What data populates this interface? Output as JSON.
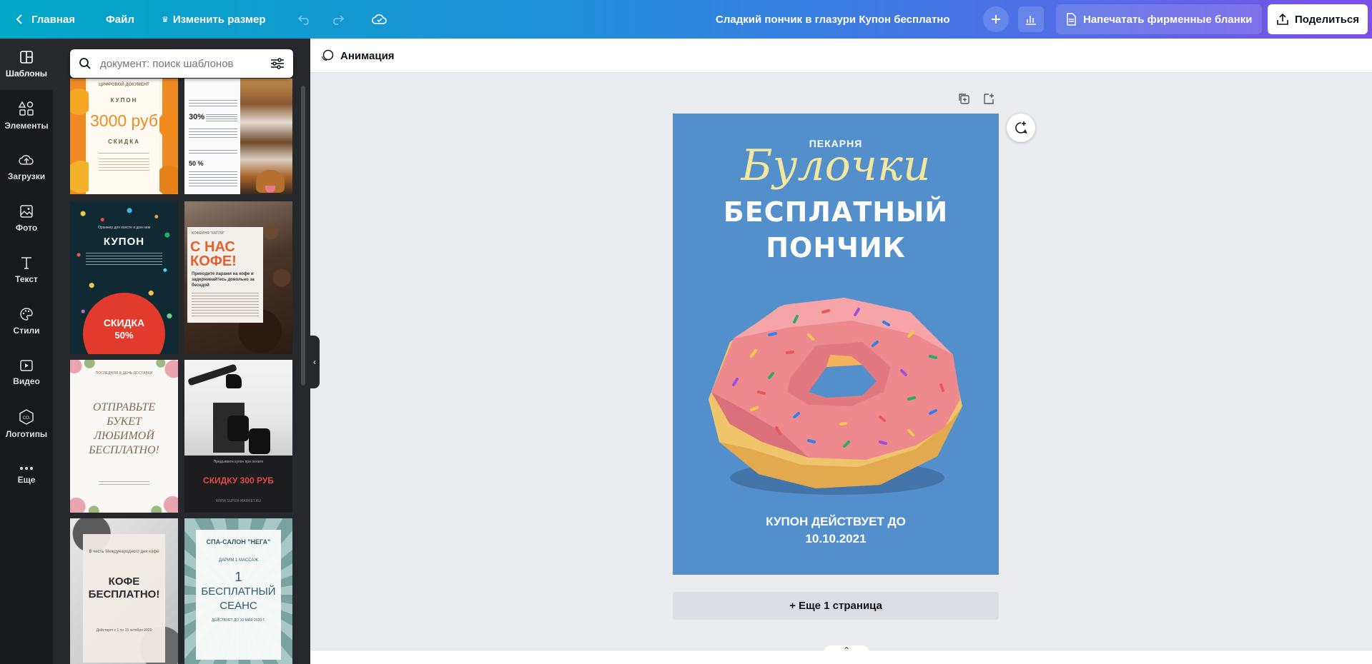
{
  "topbar": {
    "home": "Главная",
    "file": "Файл",
    "resize": "Изменить размер",
    "doc_title": "Сладкий пончик в глазури Купон бесплатно",
    "print": "Напечатать фирменные бланки",
    "share": "Поделиться"
  },
  "rail": {
    "items": [
      {
        "label": "Шаблоны",
        "icon": "templates-icon"
      },
      {
        "label": "Элементы",
        "icon": "elements-icon"
      },
      {
        "label": "Загрузки",
        "icon": "upload-icon"
      },
      {
        "label": "Фото",
        "icon": "photo-icon"
      },
      {
        "label": "Текст",
        "icon": "text-icon"
      },
      {
        "label": "Стили",
        "icon": "palette-icon"
      },
      {
        "label": "Видео",
        "icon": "video-icon"
      },
      {
        "label": "Логотипы",
        "icon": "logo-icon"
      },
      {
        "label": "Еще",
        "icon": "more-icon"
      }
    ]
  },
  "panel": {
    "search_placeholder": "документ: поиск шаблонов",
    "thumbs": {
      "t1": {
        "top": "ЦИФРОВОЙ ДОКУМЕНТ",
        "coupon": "КУПОН",
        "amount": "3000 руб",
        "discount": "СКИДКА"
      },
      "t2": {
        "p30": "30%",
        "p50": "50 %"
      },
      "t3": {
        "small": "Оранжер для холсте и дом ним",
        "title": "КУПОН",
        "discount": "СКИДКА",
        "percent": "50%"
      },
      "t4": {
        "small": "КОФЕЙНЯ \"КАПЛЯ\"",
        "title1": "С НАС",
        "title2": "КОФЕ!",
        "sub": "Приходите парами на кофе и задерживайтесь довольно за беседой"
      },
      "t5": {
        "small": "ПОСЛЕДНЯЯ В ДЕНЬ ДОСТАВКИ",
        "l1": "ОТПРАВЬТЕ",
        "l2": "БУКЕТ",
        "l3": "ЛЮБИМОЙ",
        "l4": "БЕСПЛАТНО!"
      },
      "t6": {
        "small": "Предъявите купон при оплате",
        "title": "СКИДКУ 300 РУБ",
        "url": "WWW.SUPER-MARKET.RU"
      },
      "t7": {
        "small": "В честь Международного дня кофе",
        "l1": "КОФЕ",
        "l2": "БЕСПЛАТНО!",
        "date": "Действует с 1 по 15 октября 2020"
      },
      "t8": {
        "small": "СПА-САЛОН \"НЕГА\"",
        "sub": "ДАРИМ 1 МАССАЖ",
        "l1": "1",
        "l2": "БЕСПЛАТНЫЙ",
        "l3": "СЕАНС",
        "foot": "ДЕЙСТВУЕТ ДО 10 МАЯ 2020 Г."
      }
    }
  },
  "editor": {
    "animation": "Анимация",
    "add_page": "+ Еще 1 страница"
  },
  "design": {
    "bakery_label": "ПЕКАРНЯ",
    "brand": "Булочки",
    "headline1": "БЕСПЛАТНЫЙ",
    "headline2": "ПОНЧИК",
    "valid_line1": "КУПОН ДЕЙСТВУЕТ ДО",
    "valid_line2": "10.10.2021"
  },
  "colors": {
    "page_bg": "#5390cb",
    "donut_icing": "#ee8a8e",
    "donut_dough": "#f0c46b",
    "brand_yellow": "#f3e7a0"
  }
}
